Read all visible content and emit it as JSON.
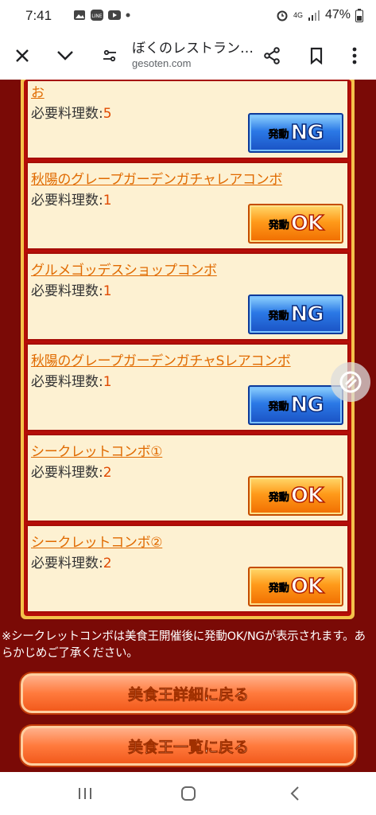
{
  "status_bar": {
    "time": "7:41",
    "battery": "47%",
    "network": "4G"
  },
  "browser": {
    "page_title": "ぼくのレストラン…",
    "url": "gesoten.com"
  },
  "combos": [
    {
      "name": "お",
      "req_label": "必要料理数:",
      "count": "5",
      "status": "NG"
    },
    {
      "name": "秋陽のグレープガーデンガチャレアコンボ",
      "req_label": "必要料理数:",
      "count": "1",
      "status": "OK"
    },
    {
      "name": "グルメゴッデスショップコンボ",
      "req_label": "必要料理数:",
      "count": "1",
      "status": "NG"
    },
    {
      "name": "秋陽のグレープガーデンガチャSレアコンボ",
      "req_label": "必要料理数:",
      "count": "1",
      "status": "NG"
    },
    {
      "name": "シークレットコンボ①",
      "req_label": "必要料理数:",
      "count": "2",
      "status": "OK"
    },
    {
      "name": "シークレットコンボ②",
      "req_label": "必要料理数:",
      "count": "2",
      "status": "OK"
    }
  ],
  "badge_prefix": "発動",
  "note": "※シークレットコンボは美食王開催後に発動OK/NGが表示されます。あらかじめご了承ください。",
  "buttons": {
    "back_detail": "美食王詳細に戻る",
    "back_list": "美食王一覧に戻る"
  },
  "colors": {
    "page_bg": "#7a0a06",
    "frame_gold": "#f4c24a",
    "card_bg": "#fdf1d2",
    "link_orange": "#e06a00",
    "ng_blue": "#2b79e6",
    "ok_orange": "#ff9a1a"
  }
}
